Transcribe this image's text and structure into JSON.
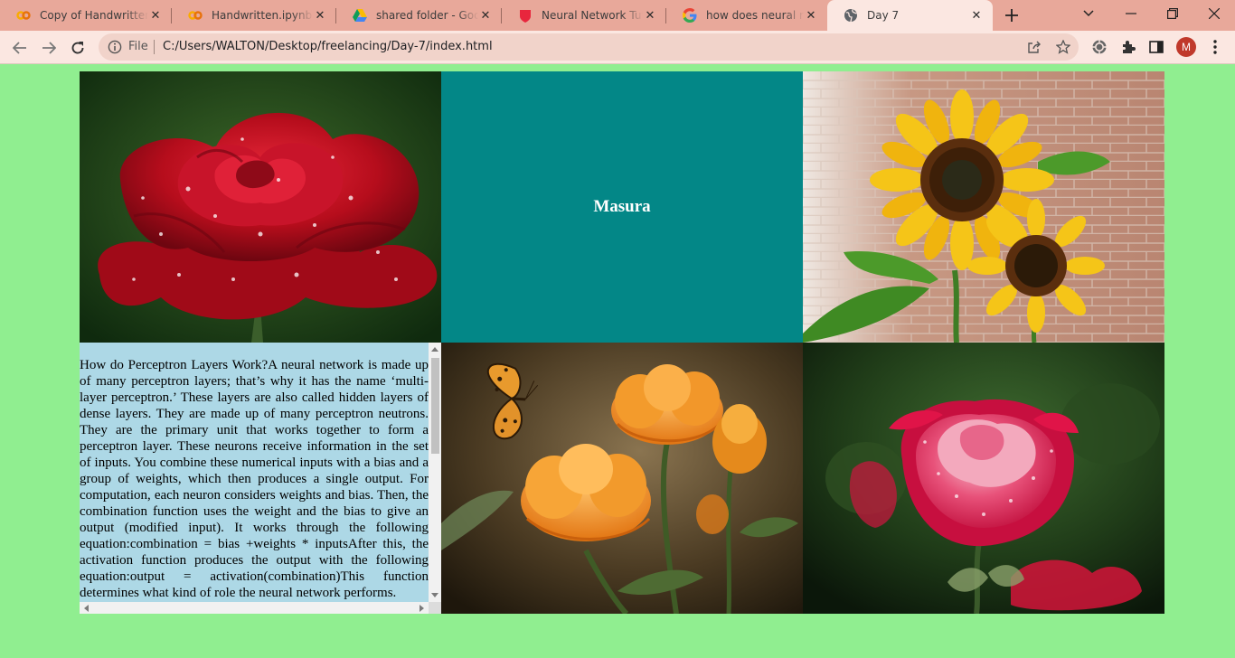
{
  "browser": {
    "tabs": [
      {
        "title": "Copy of Handwritten.ipynb",
        "icon": "colab-icon"
      },
      {
        "title": "Handwritten.ipynb - Colaboratory",
        "icon": "colab-icon"
      },
      {
        "title": "shared folder - Google Drive",
        "icon": "google-drive-icon"
      },
      {
        "title": "Neural Network Tutorial",
        "icon": "shield-icon"
      },
      {
        "title": "how does neural network work",
        "icon": "google-icon"
      },
      {
        "title": "Day 7",
        "icon": "globe-icon",
        "active": true
      }
    ],
    "omnibox": {
      "scheme_label": "File",
      "url": "C:/Users/WALTON/Desktop/freelancing/Day-7/index.html"
    },
    "profile_initial": "M"
  },
  "page": {
    "background_color": "#90ee90",
    "title_box": {
      "text": "Masura",
      "background_color": "#038787"
    },
    "article_text": "How do Perceptron Layers Work?A neural network is made up of many perceptron layers; that’s why it has the name ‘multi-layer perceptron.’ These layers are also called hidden layers of dense layers. They are made up of many perceptron neutrons. They are the primary unit that works together to form a perceptron layer. These neurons receive information in the set of inputs. You combine these numerical inputs with a bias and a group of weights, which then produces a single output. For computation, each neuron considers weights and bias. Then, the combination function uses the weight and the bias to give an output (modified input). It works through the following equation:combination = bias +weights * inputsAfter this, the activation function produces the output with the following equation:output = activation(combination)This function determines what kind of role the neural network performs.",
    "images": [
      {
        "name": "red-rose-image",
        "subject": "red rose with water droplets"
      },
      {
        "name": "sunflowers-image",
        "subject": "sunflowers against brick wall"
      },
      {
        "name": "orange-flowers-butterfly-image",
        "subject": "orange flowers with butterfly"
      },
      {
        "name": "pink-rose-image",
        "subject": "pink and red rose"
      }
    ]
  }
}
